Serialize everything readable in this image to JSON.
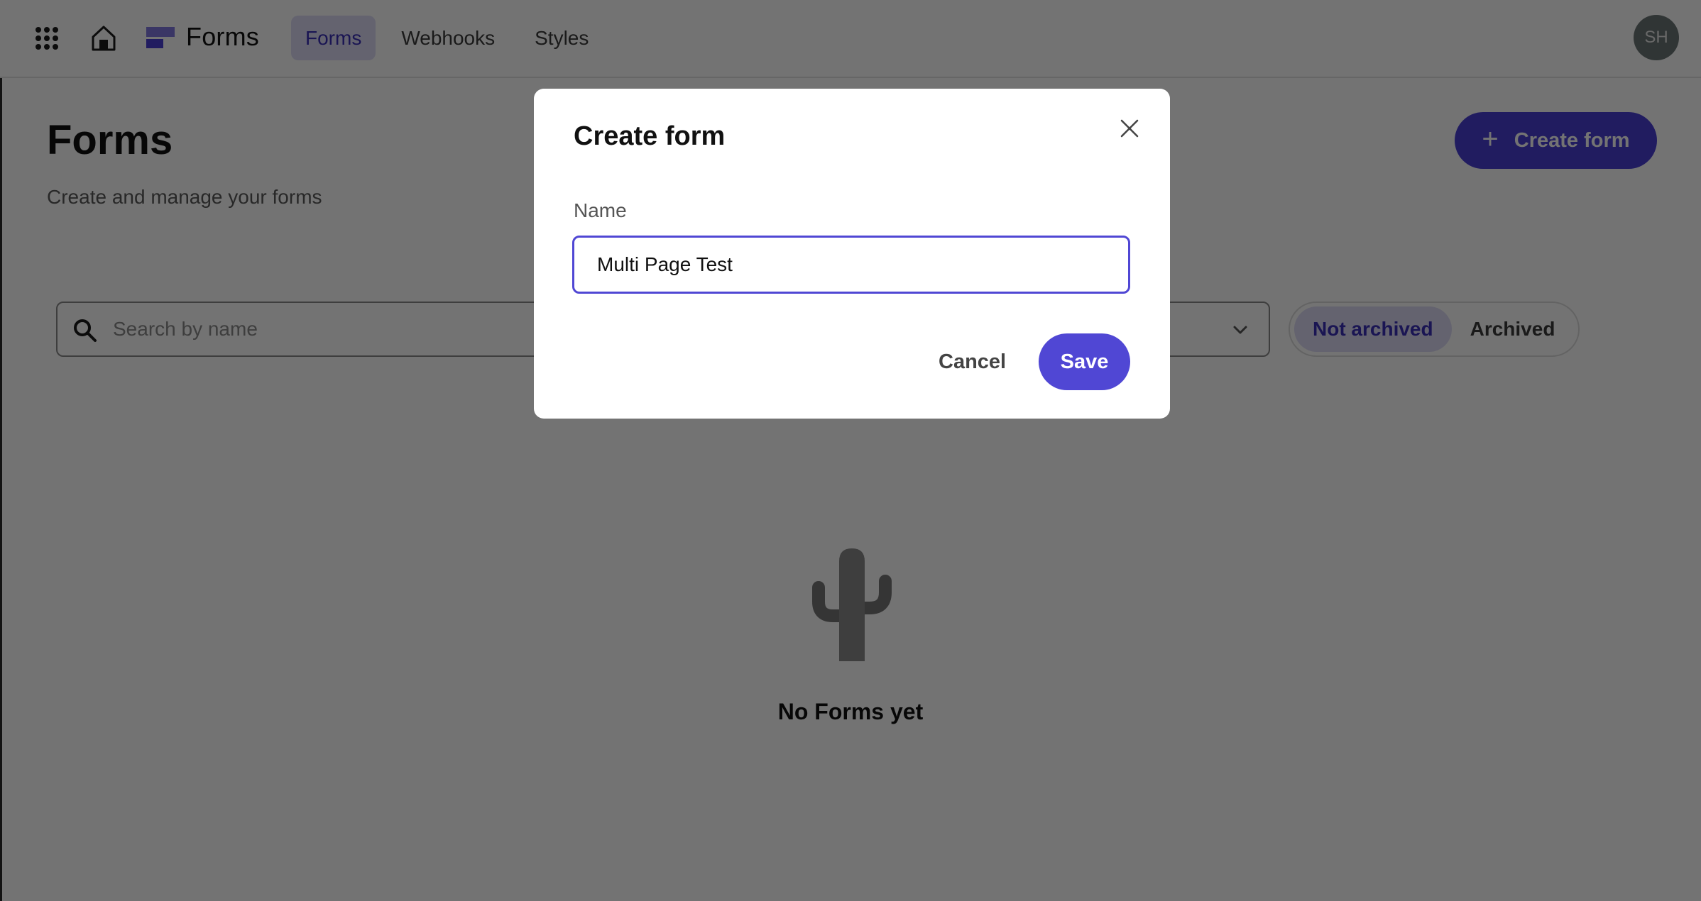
{
  "header": {
    "brand_name": "Forms",
    "nav_tabs": [
      {
        "label": "Forms",
        "active": true
      },
      {
        "label": "Webhooks",
        "active": false
      },
      {
        "label": "Styles",
        "active": false
      }
    ],
    "avatar_initials": "SH",
    "icons": {
      "apps": "grid-icon",
      "home": "home-icon",
      "logo": "forms-logo-icon"
    }
  },
  "page": {
    "title": "Forms",
    "subtitle": "Create and manage your forms",
    "create_button_label": "Create form",
    "search": {
      "placeholder": "Search by name",
      "value": ""
    },
    "filter_select": {
      "value": ""
    },
    "archive_toggle": [
      {
        "label": "Not archived",
        "active": true
      },
      {
        "label": "Archived",
        "active": false
      }
    ],
    "empty_state": {
      "icon": "cactus-icon",
      "message": "No Forms yet"
    }
  },
  "modal": {
    "title": "Create form",
    "name_label": "Name",
    "name_value": "Multi Page Test",
    "cancel_label": "Cancel",
    "save_label": "Save"
  },
  "colors": {
    "accent": "#4a3fd4",
    "accent_button": "#5047d4",
    "active_tab_bg": "#dedcf7",
    "overlay": "rgba(0,0,0,0.55)"
  }
}
